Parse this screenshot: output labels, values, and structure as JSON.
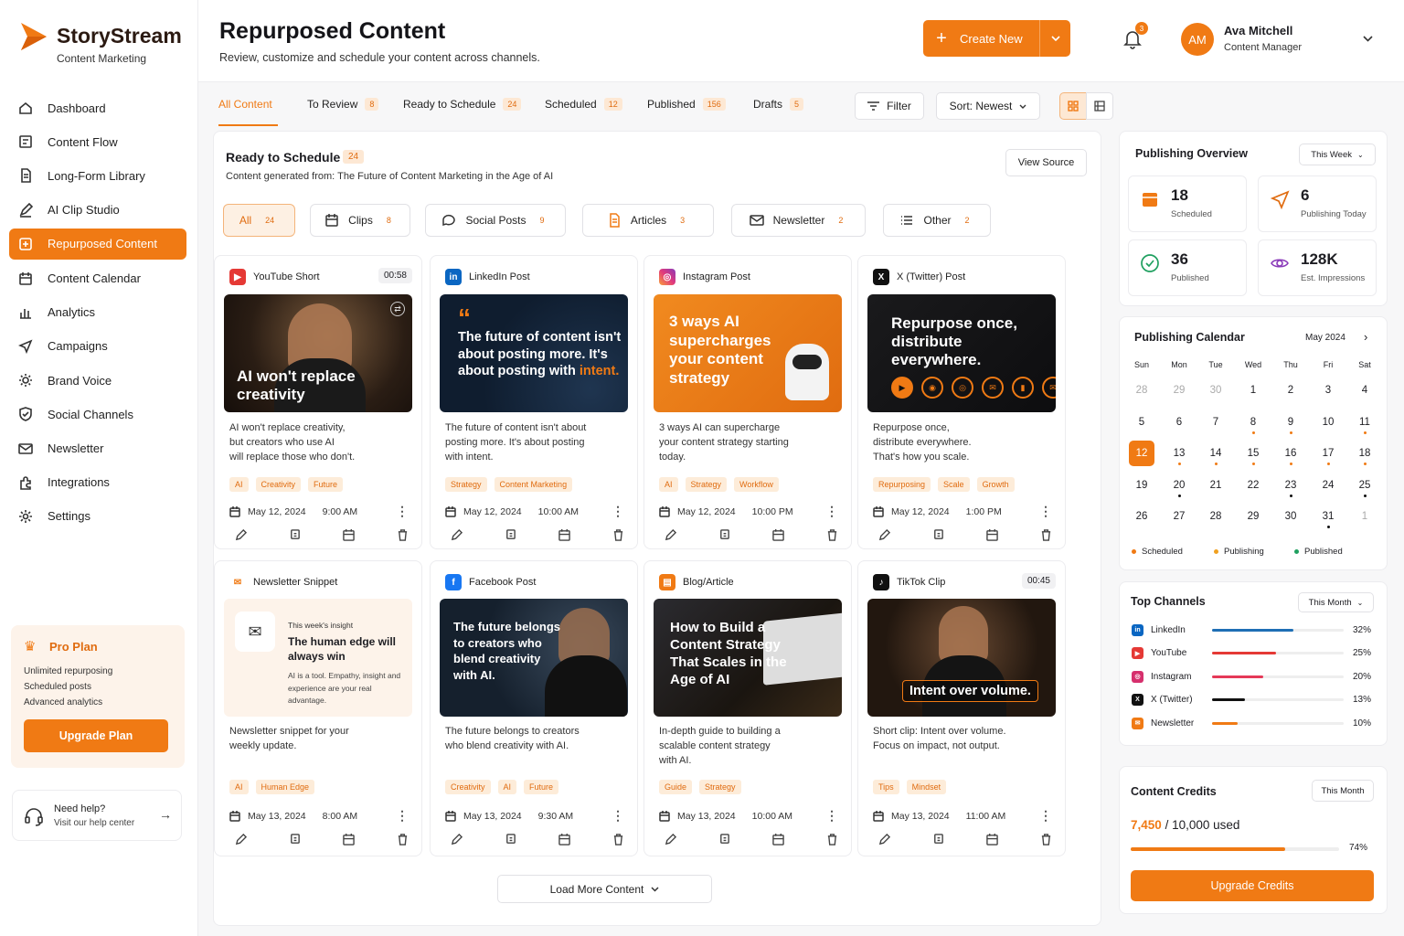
{
  "brand": {
    "name": "StoryStream",
    "tagline": "Content Marketing"
  },
  "nav": [
    {
      "label": "Dashboard",
      "icon": "home-icon"
    },
    {
      "label": "Content Flow",
      "icon": "flow-icon"
    },
    {
      "label": "Long-Form Library",
      "icon": "document-icon"
    },
    {
      "label": "AI Clip Studio",
      "icon": "pen-icon"
    },
    {
      "label": "Repurposed Content",
      "icon": "repurpose-icon",
      "active": true
    },
    {
      "label": "Content Calendar",
      "icon": "calendar-icon"
    },
    {
      "label": "Analytics",
      "icon": "bar-chart-icon"
    },
    {
      "label": "Campaigns",
      "icon": "send-icon"
    },
    {
      "label": "Brand Voice",
      "icon": "settings-voice-icon"
    },
    {
      "label": "Social Channels",
      "icon": "shield-icon"
    },
    {
      "label": "Newsletter",
      "icon": "mail-icon"
    },
    {
      "label": "Integrations",
      "icon": "puzzle-icon"
    },
    {
      "label": "Settings",
      "icon": "gear-icon"
    }
  ],
  "plan": {
    "title": "Pro Plan",
    "features": [
      "Unlimited repurposing",
      "Scheduled posts",
      "Advanced analytics"
    ],
    "button": "Upgrade Plan"
  },
  "help": {
    "title": "Need help?",
    "subtitle": "Visit our help center"
  },
  "header": {
    "title": "Repurposed Content",
    "subtitle": "Review, customize and schedule your content across channels.",
    "create_label": "Create New",
    "notif_count": "3",
    "user": {
      "initials": "AM",
      "name": "Ava Mitchell",
      "role": "Content Manager"
    }
  },
  "tabs": [
    {
      "label": "All Content",
      "count": ""
    },
    {
      "label": "To Review",
      "count": "8"
    },
    {
      "label": "Ready to Schedule",
      "count": "24"
    },
    {
      "label": "Scheduled",
      "count": "12"
    },
    {
      "label": "Published",
      "count": "156"
    },
    {
      "label": "Drafts",
      "count": "5"
    }
  ],
  "toolbar": {
    "filter": "Filter",
    "sort": "Sort: Newest"
  },
  "section": {
    "title": "Ready to Schedule",
    "count": "24",
    "source_prefix": "Content generated from: ",
    "source": "The Future of Content Marketing in the Age of AI",
    "view_source": "View Source"
  },
  "chips": [
    {
      "label": "All",
      "count": "24"
    },
    {
      "label": "Clips",
      "count": "8"
    },
    {
      "label": "Social Posts",
      "count": "9"
    },
    {
      "label": "Articles",
      "count": "3"
    },
    {
      "label": "Newsletter",
      "count": "2"
    },
    {
      "label": "Other",
      "count": "2"
    }
  ],
  "cards": [
    {
      "platform": "YouTube Short",
      "duration": "00:58",
      "thumb_text": "AI won't replace creativity",
      "desc": "AI won't replace creativity,\nbut creators who use AI\nwill replace those who don't.",
      "tags": [
        "AI",
        "Creativity",
        "Future"
      ],
      "date": "May 12, 2024",
      "time": "9:00 AM"
    },
    {
      "platform": "LinkedIn Post",
      "duration": "",
      "thumb_text": "The future of content isn't about posting more. It's about posting with",
      "thumb_accent": "intent.",
      "desc": "The future of content isn't about\nposting more. It's about posting\nwith intent.",
      "tags": [
        "Strategy",
        "Content Marketing"
      ],
      "date": "May 12, 2024",
      "time": "10:00 AM"
    },
    {
      "platform": "Instagram Post",
      "duration": "",
      "thumb_text": "3 ways AI supercharges your content strategy",
      "desc": "3 ways AI can supercharge\nyour content strategy starting\ntoday.",
      "tags": [
        "AI",
        "Strategy",
        "Workflow"
      ],
      "date": "May 12, 2024",
      "time": "10:00 PM"
    },
    {
      "platform": "X (Twitter) Post",
      "duration": "",
      "thumb_text": "Repurpose once, distribute everywhere.",
      "desc": "Repurpose once,\ndistribute everywhere.\nThat's how you scale.",
      "tags": [
        "Repurposing",
        "Scale",
        "Growth"
      ],
      "date": "May 12, 2024",
      "time": "1:00 PM"
    },
    {
      "platform": "Newsletter Snippet",
      "duration": "",
      "thumb_kicker": "This week's insight",
      "thumb_text": "The human edge will always win",
      "thumb_body": "AI is a tool. Empathy, insight and experience are your real advantage.",
      "desc": "Newsletter snippet for your\nweekly update.",
      "tags": [
        "AI",
        "Human Edge"
      ],
      "date": "May 13, 2024",
      "time": "8:00 AM"
    },
    {
      "platform": "Facebook Post",
      "duration": "",
      "thumb_text": "The future belongs to creators who blend creativity with AI.",
      "desc": "The future belongs to creators\nwho blend creativity with AI.",
      "tags": [
        "Creativity",
        "AI",
        "Future"
      ],
      "date": "May 13, 2024",
      "time": "9:30 AM"
    },
    {
      "platform": "Blog/Article",
      "duration": "",
      "thumb_text": "How to Build a Content Strategy That Scales in the Age of AI",
      "desc": "In-depth guide to building a\nscalable content strategy\nwith AI.",
      "tags": [
        "Guide",
        "Strategy"
      ],
      "date": "May 13, 2024",
      "time": "10:00 AM"
    },
    {
      "platform": "TikTok Clip",
      "duration": "00:45",
      "thumb_text": "Intent over volume.",
      "desc": "Short clip: Intent over volume.\nFocus on impact, not output.",
      "tags": [
        "Tips",
        "Mindset"
      ],
      "date": "May 13, 2024",
      "time": "11:00 AM"
    }
  ],
  "load_more": "Load More Content",
  "overview": {
    "title": "Publishing Overview",
    "range": "This Week",
    "stats": [
      {
        "value": "18",
        "label": "Scheduled"
      },
      {
        "value": "6",
        "label": "Publishing Today"
      },
      {
        "value": "36",
        "label": "Published"
      },
      {
        "value": "128K",
        "label": "Est. Impressions"
      }
    ]
  },
  "calendar": {
    "title": "Publishing Calendar",
    "month": "May 2024",
    "weekdays": [
      "Sun",
      "Mon",
      "Tue",
      "Wed",
      "Thu",
      "Fri",
      "Sat"
    ],
    "weeks": [
      [
        "28",
        "29",
        "30",
        "1",
        "2",
        "3",
        "4"
      ],
      [
        "5",
        "6",
        "7",
        "8",
        "9",
        "10",
        "11"
      ],
      [
        "12",
        "13",
        "14",
        "15",
        "16",
        "17",
        "18"
      ],
      [
        "19",
        "20",
        "21",
        "22",
        "23",
        "24",
        "25"
      ],
      [
        "26",
        "27",
        "28",
        "29",
        "30",
        "31",
        "1"
      ]
    ],
    "legend": [
      "Scheduled",
      "Publishing",
      "Published"
    ]
  },
  "channels": {
    "title": "Top Channels",
    "range": "This Month",
    "items": [
      {
        "name": "LinkedIn",
        "pct": "32%",
        "value": 0.32,
        "color": "#1f6fb5"
      },
      {
        "name": "YouTube",
        "pct": "25%",
        "value": 0.25,
        "color": "#e53935"
      },
      {
        "name": "Instagram",
        "pct": "20%",
        "value": 0.2,
        "color": "#e53958"
      },
      {
        "name": "X (Twitter)",
        "pct": "13%",
        "value": 0.13,
        "color": "#111111"
      },
      {
        "name": "Newsletter",
        "pct": "10%",
        "value": 0.1,
        "color": "#f07a14"
      }
    ]
  },
  "credits": {
    "title": "Content Credits",
    "range": "This Month",
    "used": "7,450",
    "total": "/ 10,000 used",
    "pct": "74%",
    "value": 0.74,
    "button": "Upgrade Credits"
  }
}
